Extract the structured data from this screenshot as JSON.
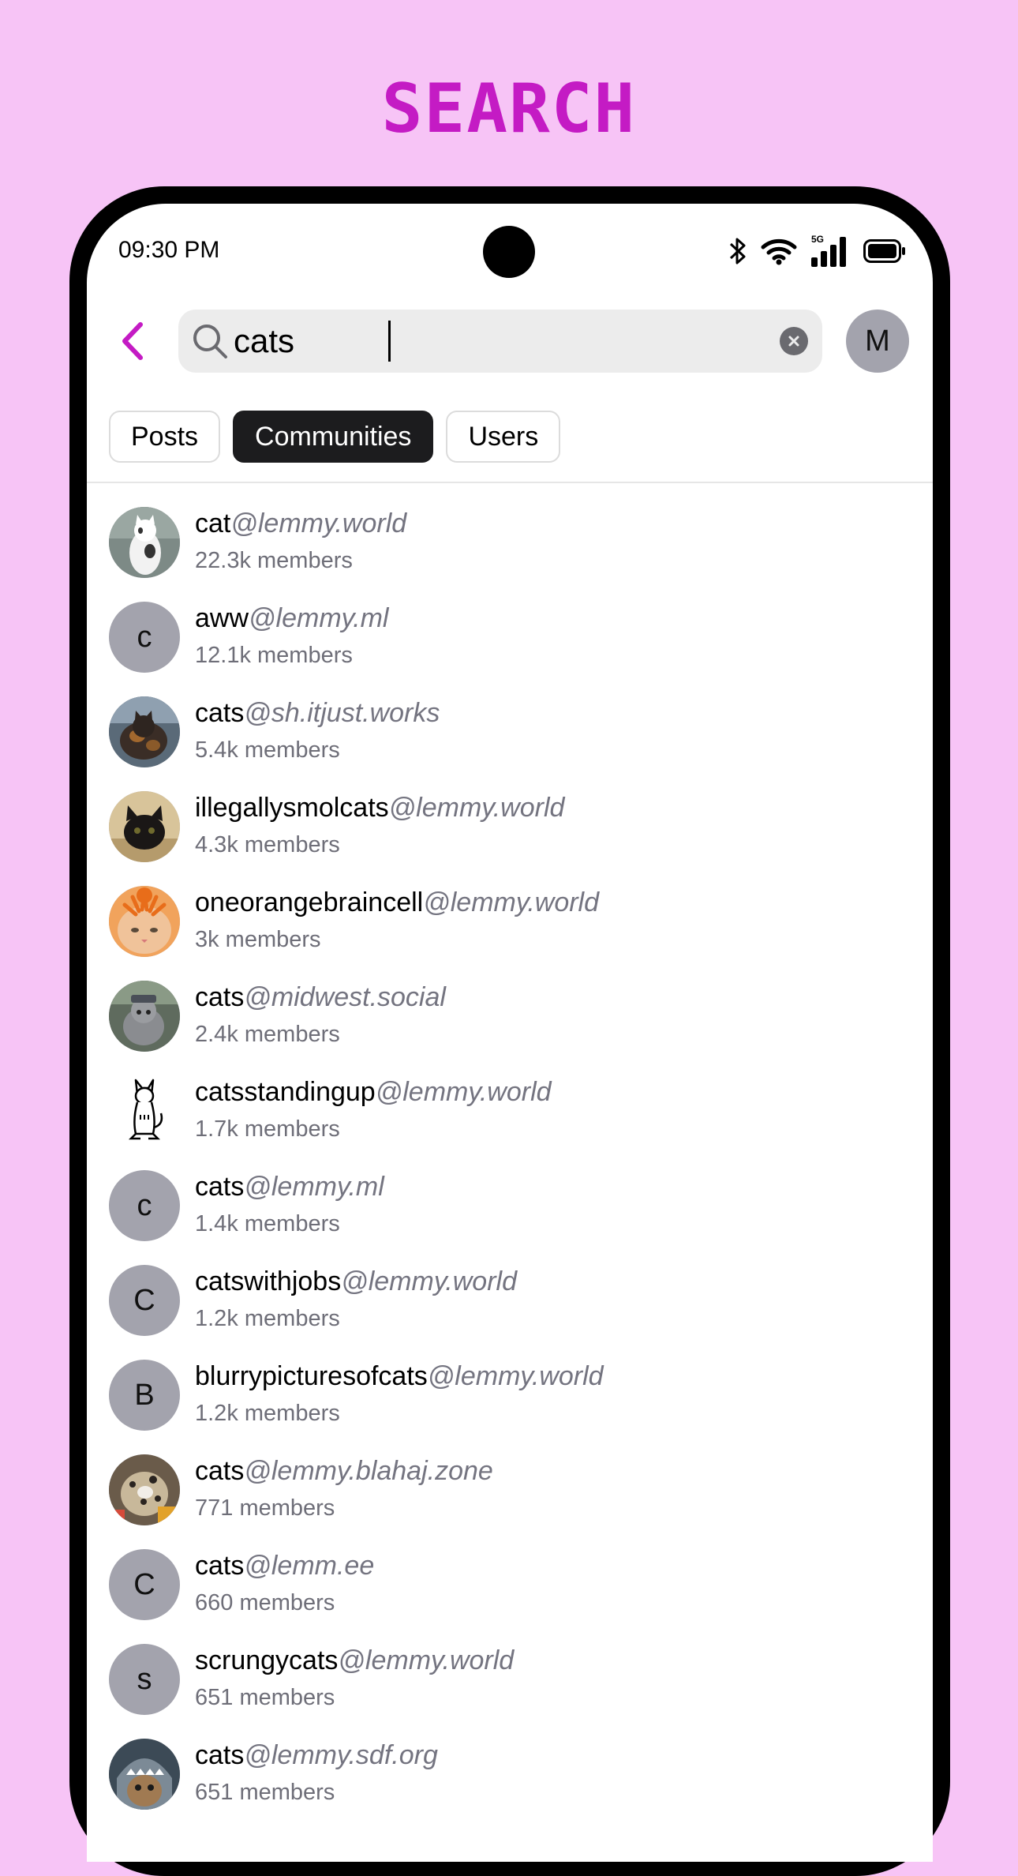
{
  "header": {
    "title": "SEARCH"
  },
  "status_bar": {
    "time": "09:30 PM",
    "network": "5G"
  },
  "search": {
    "query": "cats",
    "account_initial": "M"
  },
  "tabs": [
    {
      "label": "Posts",
      "active": false
    },
    {
      "label": "Communities",
      "active": true
    },
    {
      "label": "Users",
      "active": false
    }
  ],
  "colors": {
    "background": "#f7c4f6",
    "title": "#c41bc4",
    "back_chevron": "#c41bc4",
    "active_tab": "#1c1c1e",
    "instance_text": "#747480"
  },
  "communities": [
    {
      "name": "cat",
      "instance": "@lemmy.world",
      "members": "22.3k members",
      "avatar": {
        "type": "photo",
        "icon": "white-cat-photo"
      }
    },
    {
      "name": "aww",
      "instance": "@lemmy.ml",
      "members": "12.1k members",
      "avatar": {
        "type": "letter",
        "letter": "c"
      }
    },
    {
      "name": "cats",
      "instance": "@sh.itjust.works",
      "members": "5.4k members",
      "avatar": {
        "type": "photo",
        "icon": "tortoiseshell-cat-photo"
      }
    },
    {
      "name": "illegallysmolcats",
      "instance": "@lemmy.world",
      "members": "4.3k members",
      "avatar": {
        "type": "photo",
        "icon": "black-kitten-photo"
      }
    },
    {
      "name": "oneorangebraincell",
      "instance": "@lemmy.world",
      "members": "3k members",
      "avatar": {
        "type": "photo",
        "icon": "orange-cat-photo"
      }
    },
    {
      "name": "cats",
      "instance": "@midwest.social",
      "members": "2.4k members",
      "avatar": {
        "type": "photo",
        "icon": "grey-cat-photo"
      }
    },
    {
      "name": "catsstandingup",
      "instance": "@lemmy.world",
      "members": "1.7k members",
      "avatar": {
        "type": "drawing",
        "icon": "standing-cat-drawing"
      }
    },
    {
      "name": "cats",
      "instance": "@lemmy.ml",
      "members": "1.4k members",
      "avatar": {
        "type": "letter",
        "letter": "c"
      }
    },
    {
      "name": "catswithjobs",
      "instance": "@lemmy.world",
      "members": "1.2k members",
      "avatar": {
        "type": "letter",
        "letter": "C"
      }
    },
    {
      "name": "blurrypicturesofcats",
      "instance": "@lemmy.world",
      "members": "1.2k members",
      "avatar": {
        "type": "letter",
        "letter": "B"
      }
    },
    {
      "name": "cats",
      "instance": "@lemmy.blahaj.zone",
      "members": "771 members",
      "avatar": {
        "type": "photo",
        "icon": "bengal-cat-photo"
      }
    },
    {
      "name": "cats",
      "instance": "@lemm.ee",
      "members": "660 members",
      "avatar": {
        "type": "letter",
        "letter": "C"
      }
    },
    {
      "name": "scrungycats",
      "instance": "@lemmy.world",
      "members": "651 members",
      "avatar": {
        "type": "letter",
        "letter": "s"
      }
    },
    {
      "name": "cats",
      "instance": "@lemmy.sdf.org",
      "members": "651 members",
      "avatar": {
        "type": "photo",
        "icon": "shark-costume-cat-photo"
      }
    }
  ]
}
